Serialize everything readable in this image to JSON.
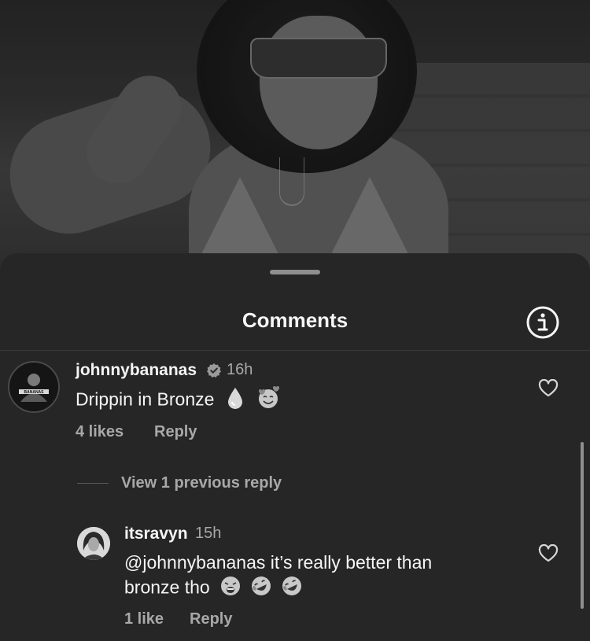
{
  "sheet": {
    "title": "Comments"
  },
  "comments": [
    {
      "username": "johnnybananas",
      "verified": true,
      "time": "16h",
      "text": "Drippin in Bronze",
      "likes": "4 likes",
      "reply_label": "Reply",
      "view_replies": "View 1 previous reply"
    }
  ],
  "reply": {
    "username": "itsravyn",
    "time": "15h",
    "text_line1": "@johnnybananas it’s really better than",
    "text_line2": "bronze tho",
    "likes": "1 like",
    "reply_label": "Reply"
  },
  "icons": {
    "info": "info-icon",
    "heart": "heart-icon",
    "verified": "verified-badge-icon",
    "droplet": "droplet-emoji",
    "smiling_hearts": "smiling-face-with-hearts-emoji",
    "weary": "weary-face-emoji",
    "rolling_laughing": "rolling-on-floor-laughing-emoji"
  },
  "colors": {
    "sheet_bg": "#262626",
    "text_primary": "#f5f5f5",
    "text_secondary": "#a8a8a8"
  }
}
